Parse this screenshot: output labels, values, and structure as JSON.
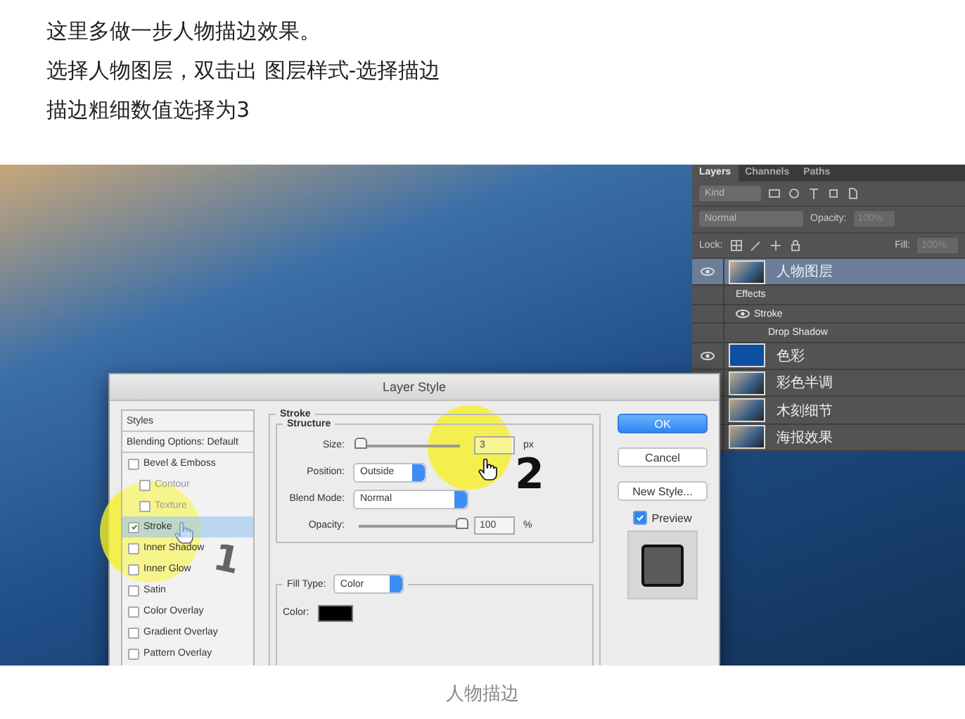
{
  "article": {
    "lines": [
      "这里多做一步人物描边效果。",
      "选择人物图层，双击出 图层样式-选择描边",
      "描边粗细数值选择为3"
    ]
  },
  "figure": {
    "layers_panel": {
      "tabs": [
        {
          "label": "Layers",
          "selected": true
        },
        {
          "label": "Channels",
          "selected": false
        },
        {
          "label": "Paths",
          "selected": false
        }
      ],
      "filter": {
        "value": "Kind"
      },
      "blend": {
        "value": "Normal"
      },
      "opacity": {
        "label": "Opacity:",
        "value": "100%",
        "disabled": true
      },
      "lock": {
        "label": "Lock:"
      },
      "fill": {
        "label": "Fill:",
        "value": "100%",
        "disabled": true
      },
      "layers": [
        {
          "name": "人物图层",
          "kind": "photo",
          "visible": true,
          "selected": true,
          "effects": {
            "label": "Effects",
            "children": [
              {
                "name": "Stroke",
                "visible": true
              },
              {
                "name": "Drop Shadow",
                "visible": false
              }
            ]
          }
        },
        {
          "name": "色彩",
          "kind": "fill",
          "visible": true,
          "selected": false
        },
        {
          "name": "彩色半调",
          "kind": "photo",
          "selected": false
        },
        {
          "name": "木刻细节",
          "kind": "photo",
          "selected": false
        },
        {
          "name": "海报效果",
          "kind": "photo",
          "selected": false
        }
      ]
    },
    "dialog": {
      "title": "Layer Style",
      "styles": [
        {
          "label": "Styles",
          "kind": "header",
          "selected": false
        },
        {
          "label": "Blending Options: Default",
          "kind": "header",
          "selected": false
        },
        {
          "label": "Bevel & Emboss",
          "kind": "check",
          "checked": false,
          "selected": false,
          "children": [
            {
              "label": "Contour",
              "checked": false,
              "disabled": true
            },
            {
              "label": "Texture",
              "checked": false,
              "disabled": true
            }
          ]
        },
        {
          "label": "Stroke",
          "kind": "check",
          "checked": true,
          "selected": true
        },
        {
          "label": "Inner Shadow",
          "kind": "check",
          "checked": false,
          "selected": false
        },
        {
          "label": "Inner Glow",
          "kind": "check",
          "checked": false,
          "selected": false
        },
        {
          "label": "Satin",
          "kind": "check",
          "checked": false,
          "selected": false
        },
        {
          "label": "Color Overlay",
          "kind": "check",
          "checked": false,
          "selected": false
        },
        {
          "label": "Gradient Overlay",
          "kind": "check",
          "checked": false,
          "selected": false
        },
        {
          "label": "Pattern Overlay",
          "kind": "check",
          "checked": false,
          "selected": false
        }
      ],
      "section": "Stroke",
      "structure": {
        "legend": "Structure",
        "size": {
          "label": "Size:",
          "level": 0,
          "value": "3",
          "unit": "px"
        },
        "position": {
          "label": "Position:",
          "value": "Outside"
        },
        "blend_mode": {
          "label": "Blend Mode:",
          "value": "Normal"
        },
        "opacity": {
          "label": "Opacity:",
          "level": 1,
          "value": "100",
          "unit": "%"
        }
      },
      "fill": {
        "label": "Fill Type:",
        "value": "Color",
        "color_label": "Color:",
        "color": "#000000"
      },
      "buttons": [
        {
          "label": "OK",
          "primary": true
        },
        {
          "label": "Cancel",
          "primary": false
        },
        {
          "label": "New Style...",
          "primary": false
        }
      ],
      "preview": {
        "label": "Preview",
        "checked": true
      }
    },
    "annotations": [
      {
        "number": "1"
      },
      {
        "number": "2"
      }
    ]
  },
  "caption": "人物描边"
}
